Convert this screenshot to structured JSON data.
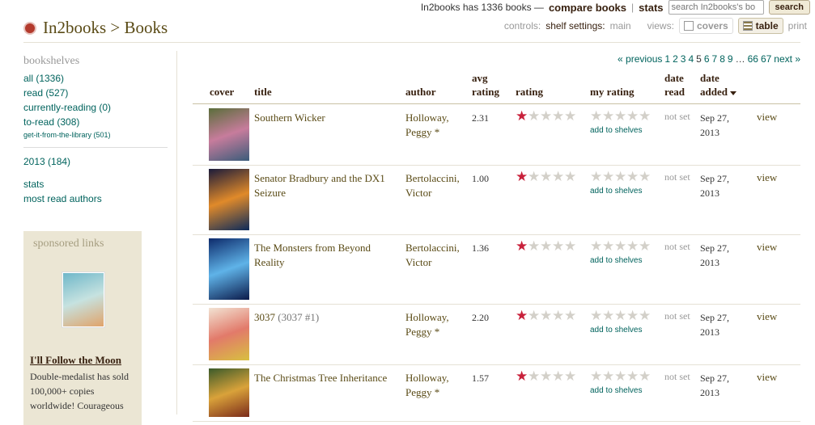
{
  "topbar": {
    "summary": "In2books has 1336 books —",
    "compare_label": "compare books",
    "stats_label": "stats",
    "search_placeholder": "search In2books's bo",
    "search_button": "search"
  },
  "header": {
    "breadcrumb": "In2books > Books"
  },
  "controls": {
    "controls_label": "controls:",
    "shelf_settings_label": "shelf settings:",
    "shelf_settings_value": "main",
    "views_label": "views:",
    "covers_label": "covers",
    "table_label": "table",
    "print_label": "print"
  },
  "sidebar": {
    "heading": "bookshelves",
    "shelves": [
      {
        "label": "all (1336)"
      },
      {
        "label": "read (527)"
      },
      {
        "label": "currently-reading (0)"
      },
      {
        "label": "to-read (308)"
      },
      {
        "label": "get-it-from-the-library  (501)"
      }
    ],
    "year_shelf": "2013 (184)",
    "links": [
      "stats",
      "most read authors"
    ]
  },
  "sponsor": {
    "heading": "sponsored links",
    "ad_title": "I'll Follow the Moon",
    "ad_text": "Double-medalist has sold 100,000+ copies worldwide! Courageous"
  },
  "pager": {
    "previous": "« previous",
    "pages": [
      "1",
      "2",
      "3",
      "4",
      "5",
      "6",
      "7",
      "8",
      "9"
    ],
    "current_page": "5",
    "ellipsis": "…",
    "last_pages": [
      "66",
      "67"
    ],
    "next": "next »"
  },
  "table": {
    "columns": {
      "cover": "cover",
      "title": "title",
      "author": "author",
      "avg_rating_1": "avg",
      "avg_rating_2": "rating",
      "rating": "rating",
      "my_rating": "my rating",
      "date_read_1": "date",
      "date_read_2": "read",
      "date_added_1": "date",
      "date_added_2": "added"
    },
    "rows": [
      {
        "title": "Southern Wicker",
        "series": "",
        "author_last": "Holloway,",
        "author_first": "Peggy",
        "author_star": "*",
        "avg": "2.31",
        "rating": 1,
        "add_to_shelves": "add to shelves",
        "date_read": "not set",
        "date_added_1": "Sep 27,",
        "date_added_2": "2013",
        "view": "view",
        "cover_colors": [
          "#5a6e3a",
          "#c77c9c",
          "#3b5c7a"
        ]
      },
      {
        "title": "Senator Bradbury and the DX1 Seizure",
        "series": "",
        "author_last": "Bertolaccini,",
        "author_first": "Victor",
        "author_star": "",
        "avg": "1.00",
        "rating": 1,
        "add_to_shelves": "add to shelves",
        "date_read": "not set",
        "date_added_1": "Sep 27,",
        "date_added_2": "2013",
        "view": "view",
        "cover_colors": [
          "#1a1a3a",
          "#e08a2a",
          "#0b2a5a"
        ]
      },
      {
        "title": "The Monsters from Beyond Reality",
        "series": "",
        "author_last": "Bertolaccini,",
        "author_first": "Victor",
        "author_star": "",
        "avg": "1.36",
        "rating": 1,
        "add_to_shelves": "add to shelves",
        "date_read": "not set",
        "date_added_1": "Sep 27,",
        "date_added_2": "2013",
        "view": "view",
        "cover_colors": [
          "#0d2a6b",
          "#5fb3e8",
          "#0b1a4a"
        ]
      },
      {
        "title": "3037",
        "series": "(3037 #1)",
        "author_last": "Holloway,",
        "author_first": "Peggy",
        "author_star": "*",
        "avg": "2.20",
        "rating": 1,
        "add_to_shelves": "add to shelves",
        "date_read": "not set",
        "date_added_1": "Sep 27,",
        "date_added_2": "2013",
        "view": "view",
        "cover_colors": [
          "#f2e3d3",
          "#e27a6a",
          "#d8c040"
        ]
      },
      {
        "title": "The Christmas Tree Inheritance",
        "series": "",
        "author_last": "Holloway,",
        "author_first": "Peggy",
        "author_star": "*",
        "avg": "1.57",
        "rating": 1,
        "add_to_shelves": "add to shelves",
        "date_read": "not set",
        "date_added_1": "Sep 27,",
        "date_added_2": "2013",
        "view": "view",
        "cover_colors": [
          "#3a5a2a",
          "#d9a23a",
          "#7a2a1a"
        ]
      }
    ]
  }
}
